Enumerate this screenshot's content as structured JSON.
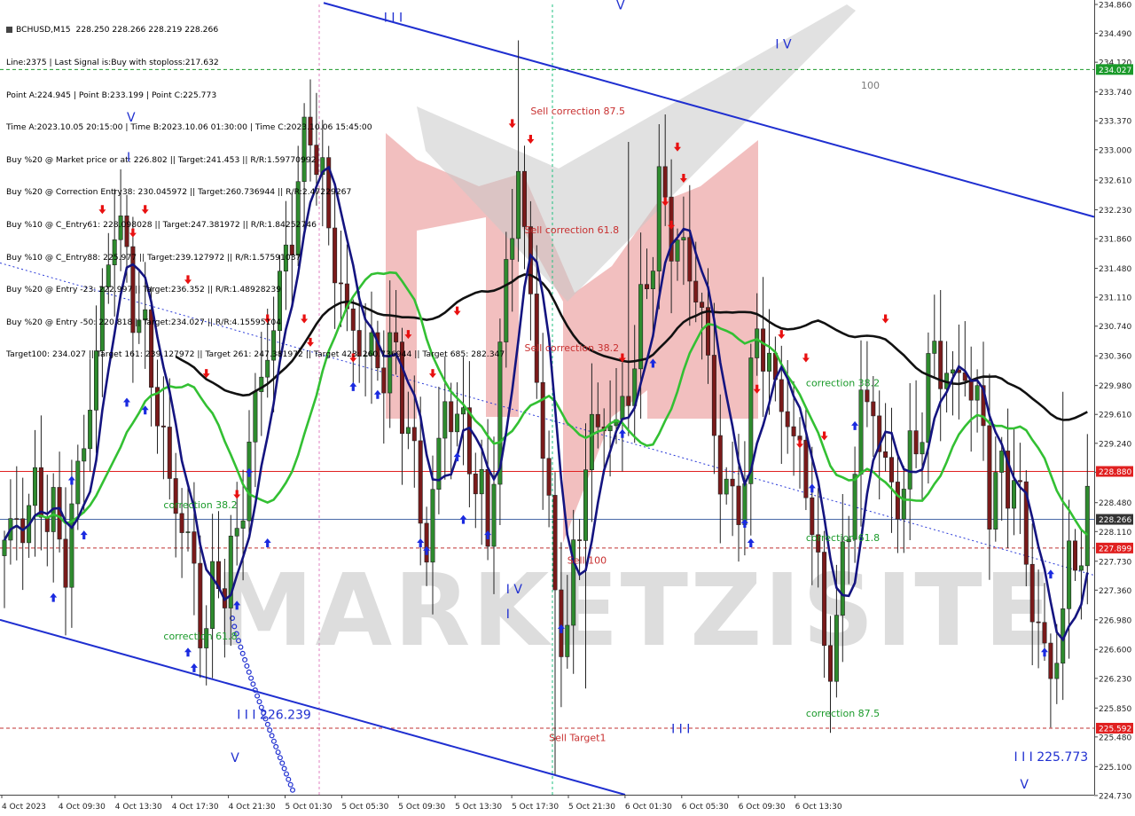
{
  "header": {
    "symbol": "BCHUSD,M15",
    "ohlc": "228.250 228.266 228.219 228.266",
    "lines": [
      "Line:2375 | Last Signal is:Buy with stoploss:217.632",
      "Point A:224.945 | Point B:233.199 | Point C:225.773",
      "Time A:2023.10.05 20:15:00 | Time B:2023.10.06 01:30:00 | Time C:2023.10.06 15:45:00",
      "Buy %20 @ Market price or at: 226.802 || Target:241.453 || R/R:1.59770992",
      "Buy %20 @ Correction Entry38: 230.045972 || Target:260.736944 || R/R:2.47229267",
      "Buy %10 @ C_Entry61: 228.098028 || Target:247.381972 || R/R:1.84252746",
      "Buy %10 @ C_Entry88: 225.977 || Target:239.127972 || R/R:1.57591037",
      "Buy %20 @ Entry -23: 222.997 || Target:236.352 || R/R:1.48928239",
      "Buy %20 @ Entry -50: 220.818 || Target:234.027 || R/R:4.15595104",
      "Target100: 234.027 || Target 161: 239.127972 || Target 261: 247.381972 || Target 423: 260.736944 || Target 685: 282.347"
    ]
  },
  "chart_data": {
    "type": "candlestick",
    "symbol": "BCHUSD",
    "timeframe": "M15",
    "ylim": [
      224.74,
      234.86
    ],
    "y_ticks": [
      "234.860",
      "234.490",
      "234.120",
      "233.740",
      "233.370",
      "233.000",
      "232.610",
      "232.230",
      "231.860",
      "231.480",
      "231.110",
      "230.740",
      "230.360",
      "229.980",
      "229.610",
      "229.240",
      "228.870",
      "228.480",
      "228.110",
      "227.730",
      "227.360",
      "226.980",
      "226.600",
      "226.230",
      "225.850",
      "225.480",
      "225.100",
      "224.730"
    ],
    "x_ticks": [
      "4 Oct 2023",
      "4 Oct 09:30",
      "4 Oct 13:30",
      "4 Oct 17:30",
      "4 Oct 21:30",
      "5 Oct 01:30",
      "5 Oct 05:30",
      "5 Oct 09:30",
      "5 Oct 13:30",
      "5 Oct 17:30",
      "5 Oct 21:30",
      "6 Oct 01:30",
      "6 Oct 05:30",
      "6 Oct 09:30",
      "6 Oct 13:30"
    ],
    "price_tags": [
      {
        "label": "234.027",
        "value": 234.027,
        "color": "#1a9a2a"
      },
      {
        "label": "228.880",
        "value": 228.88,
        "color": "#e02020"
      },
      {
        "label": "228.266",
        "value": 228.266,
        "color": "#333333"
      },
      {
        "label": "227.899",
        "value": 227.899,
        "color": "#e02020"
      },
      {
        "label": "225.592",
        "value": 225.592,
        "color": "#e02020"
      }
    ],
    "levels": [
      {
        "name": "target100",
        "value": 234.027,
        "color": "#1a9a2a",
        "style": "dashed"
      },
      {
        "name": "stop",
        "value": 228.88,
        "color": "#e02020",
        "style": "solid"
      },
      {
        "name": "last",
        "value": 228.266,
        "color": "#4a6aa8",
        "style": "solid"
      },
      {
        "name": "sell100",
        "value": 227.899,
        "color": "#c03030",
        "style": "dashed"
      },
      {
        "name": "selltarget1",
        "value": 225.592,
        "color": "#c03030",
        "style": "dashed"
      }
    ],
    "annotations": [
      {
        "text": "100",
        "color": "#7a7a7a",
        "price": 233.78,
        "slot": 140
      },
      {
        "text": "Sell correction 87.5",
        "color": "#c83030",
        "price": 233.45,
        "slot": 86
      },
      {
        "text": "Sell correction 61.8",
        "color": "#c83030",
        "price": 231.93,
        "slot": 85
      },
      {
        "text": "Sell correction 38.2",
        "color": "#c83030",
        "price": 230.42,
        "slot": 85
      },
      {
        "text": "correction 38.2",
        "color": "#1a9a2a",
        "price": 229.97,
        "slot": 131
      },
      {
        "text": "correction 38.2",
        "color": "#1a9a2a",
        "price": 228.41,
        "slot": 26
      },
      {
        "text": "correction 61.8",
        "color": "#1a9a2a",
        "price": 227.99,
        "slot": 131
      },
      {
        "text": "Sell 100",
        "color": "#c83030",
        "price": 227.7,
        "slot": 92
      },
      {
        "text": "correction 61.8",
        "color": "#1a9a2a",
        "price": 226.73,
        "slot": 26
      },
      {
        "text": "correction 87.5",
        "color": "#1a9a2a",
        "price": 225.74,
        "slot": 131
      },
      {
        "text": "Sell Target1",
        "color": "#c83030",
        "price": 225.43,
        "slot": 89
      }
    ],
    "wave_labels": [
      {
        "text": "I I I",
        "price": 234.64,
        "slot": 62
      },
      {
        "text": "V",
        "price": 234.8,
        "slot": 100
      },
      {
        "text": "I V",
        "price": 234.3,
        "slot": 126
      },
      {
        "text": "I",
        "price": 232.85,
        "slot": 20
      },
      {
        "text": "V",
        "price": 233.36,
        "slot": 20
      },
      {
        "text": "I V",
        "price": 227.32,
        "slot": 82
      },
      {
        "text": "I",
        "price": 227.0,
        "slot": 82
      },
      {
        "text": "I I I  226.239",
        "price": 225.71,
        "slot": 38
      },
      {
        "text": "V",
        "price": 225.16,
        "slot": 37
      },
      {
        "text": "I I I",
        "price": 225.53,
        "slot": 109
      },
      {
        "text": "I I I  225.773",
        "price": 225.17,
        "slot": 165
      },
      {
        "text": "V",
        "price": 224.82,
        "slot": 166
      }
    ],
    "watermark": "MARKETZISITE"
  }
}
